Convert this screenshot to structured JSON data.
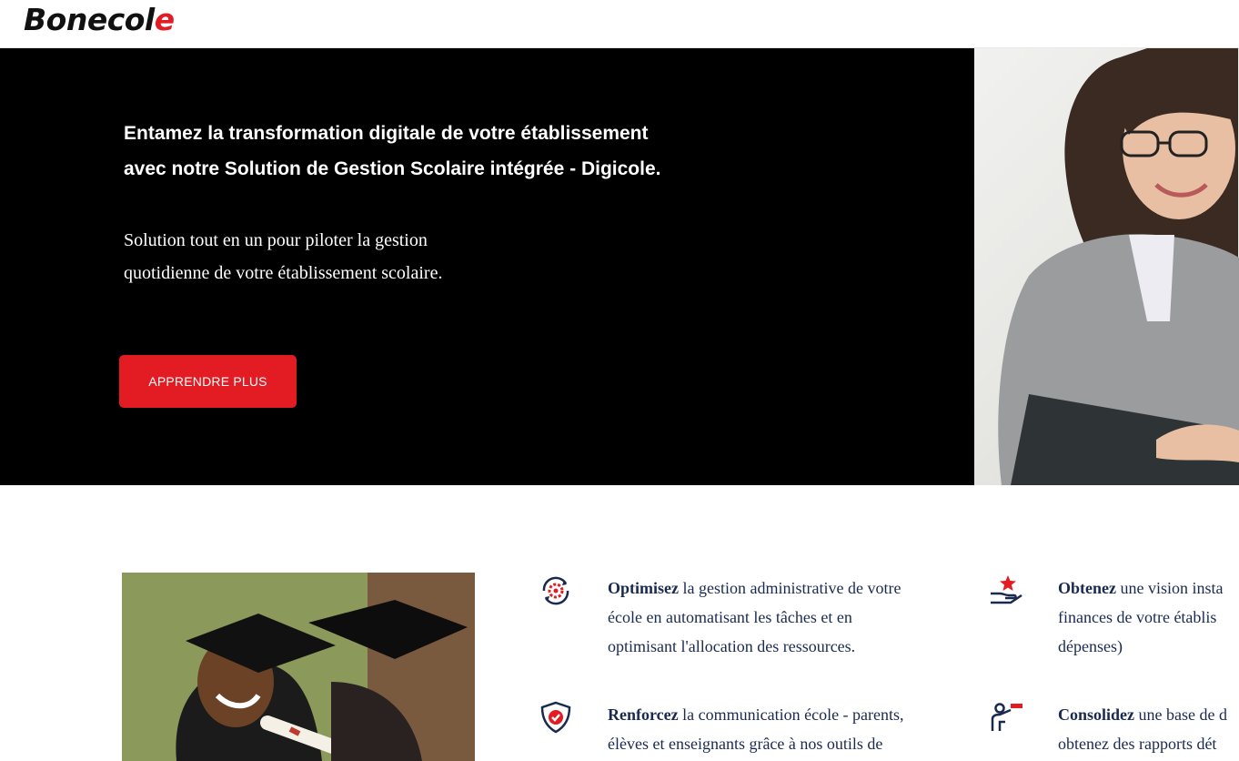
{
  "header": {
    "logo_main": "Bonecol",
    "logo_accent": "e"
  },
  "hero": {
    "title_line1": "Entamez la transformation digitale de votre établissement",
    "title_line2": "avec notre Solution de Gestion Scolaire intégrée - Digicole.",
    "subtitle_line1": "Solution tout en un pour piloter la gestion",
    "subtitle_line2": "quotidienne de votre établissement scolaire.",
    "cta_label": "APPRENDRE PLUS"
  },
  "features": [
    {
      "bold": "Optimisez",
      "line1": " la gestion administrative de votre",
      "line2": "école en automatisant les tâches et en",
      "line3": "optimisant l'allocation des ressources.",
      "icon": "gear-cycle-icon"
    },
    {
      "bold": "Obtenez",
      "line1": " une vision insta",
      "line2": "finances de votre établis",
      "line3": "dépenses)",
      "icon": "hand-star-icon"
    },
    {
      "bold": "Renforcez",
      "line1": " la communication école - parents,",
      "line2": "élèves et enseignants grâce à nos outils de",
      "icon": "shield-check-icon"
    },
    {
      "bold": "Consolidez",
      "line1": " une base de d",
      "line2": "obtenez des rapports dét",
      "icon": "presenter-flag-icon"
    }
  ],
  "colors": {
    "brand_red": "#e31b23",
    "text_navy": "#1a2a4f",
    "hero_bg": "#000000"
  }
}
